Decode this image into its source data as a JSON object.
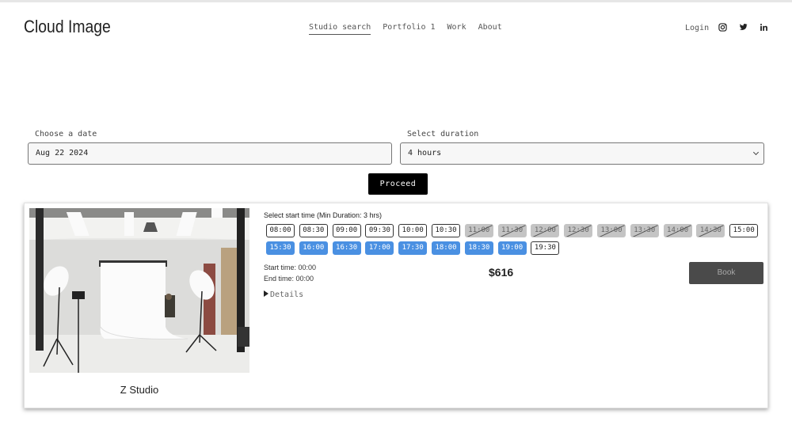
{
  "header": {
    "brand": "Cloud Image",
    "nav": [
      "Studio search",
      "Portfolio 1",
      "Work",
      "About"
    ],
    "active_nav": "Studio search",
    "login": "Login",
    "social_icons": [
      "instagram-icon",
      "twitter-icon",
      "linkedin-icon"
    ]
  },
  "form": {
    "date_label": "Choose a date",
    "date_value": "Aug 22 2024",
    "duration_label": "Select duration",
    "duration_value": "4 hours",
    "proceed_label": "Proceed"
  },
  "studio": {
    "name": "Z Studio",
    "slot_title": "Select start time (Min Duration: 3 hrs)",
    "slots": [
      {
        "time": "08:00",
        "state": "available"
      },
      {
        "time": "08:30",
        "state": "available"
      },
      {
        "time": "09:00",
        "state": "available"
      },
      {
        "time": "09:30",
        "state": "available"
      },
      {
        "time": "10:00",
        "state": "available"
      },
      {
        "time": "10:30",
        "state": "available"
      },
      {
        "time": "11:00",
        "state": "taken"
      },
      {
        "time": "11:30",
        "state": "taken"
      },
      {
        "time": "12:00",
        "state": "taken"
      },
      {
        "time": "12:30",
        "state": "taken"
      },
      {
        "time": "13:00",
        "state": "taken"
      },
      {
        "time": "13:30",
        "state": "taken"
      },
      {
        "time": "14:00",
        "state": "taken"
      },
      {
        "time": "14:30",
        "state": "taken"
      },
      {
        "time": "15:00",
        "state": "available"
      },
      {
        "time": "15:30",
        "state": "selected"
      },
      {
        "time": "16:00",
        "state": "selected"
      },
      {
        "time": "16:30",
        "state": "selected"
      },
      {
        "time": "17:00",
        "state": "selected"
      },
      {
        "time": "17:30",
        "state": "selected"
      },
      {
        "time": "18:00",
        "state": "selected"
      },
      {
        "time": "18:30",
        "state": "selected"
      },
      {
        "time": "19:00",
        "state": "selected"
      },
      {
        "time": "19:30",
        "state": "available"
      }
    ],
    "start_time": "Start time: 00:00",
    "end_time": "End time: 00:00",
    "price": "$616",
    "book_label": "Book",
    "details_label": "Details"
  },
  "colors": {
    "selected_slot": "#4a90e2",
    "taken_slot": "#c4c4c4",
    "book_button": "#4a4a4a",
    "proceed_button": "#000000"
  }
}
